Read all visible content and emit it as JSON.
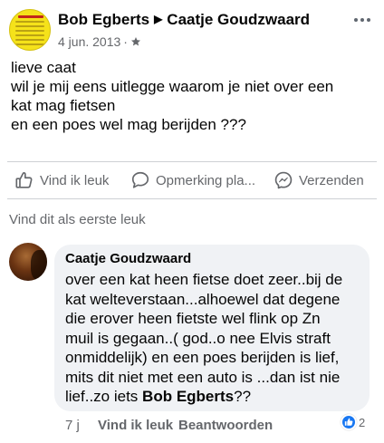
{
  "post": {
    "author": "Bob Egberts",
    "target": "Caatje Goudzwaard",
    "arrow": "▶",
    "date": "4 jun. 2013",
    "dot": "·",
    "audience_icon": "star-icon",
    "text_lines": [
      "lieve caat",
      "wil je mij eens uitlegge waarom je niet over een",
      "kat mag fietsen",
      "en een poes wel mag berijden ???"
    ]
  },
  "actions": {
    "like": {
      "label": "Vind ik leuk",
      "icon": "thumbs-up-icon"
    },
    "comment": {
      "label": "Opmerking pla...",
      "icon": "comment-icon"
    },
    "share": {
      "label": "Verzenden",
      "icon": "messenger-icon"
    }
  },
  "first_like_prompt": "Vind dit als eerste leuk",
  "comment": {
    "author": "Caatje Goudzwaard",
    "lines": [
      "over een kat heen fietse doet zeer..bij de",
      "kat welteverstaan...alhoewel dat degene",
      "die erover heen fietste wel flink op Zn",
      "muil is gegaan..( god..o nee Elvis straft",
      "onmiddelijk) en een poes berijden is lief,",
      "mits dit niet met een auto is ...dan ist nie"
    ],
    "last_line_prefix": "lief..zo iets ",
    "mention": "Bob Egberts",
    "last_line_suffix": "??",
    "time": "7 j",
    "like_label": "Vind ik leuk",
    "reply_label": "Beantwoorden",
    "reaction_count": "2",
    "reaction_icon": "like-reaction-icon"
  },
  "colors": {
    "accent": "#1877f2",
    "secondary_text": "#65676b",
    "bubble": "#f0f2f5",
    "divider": "#ced0d4"
  }
}
